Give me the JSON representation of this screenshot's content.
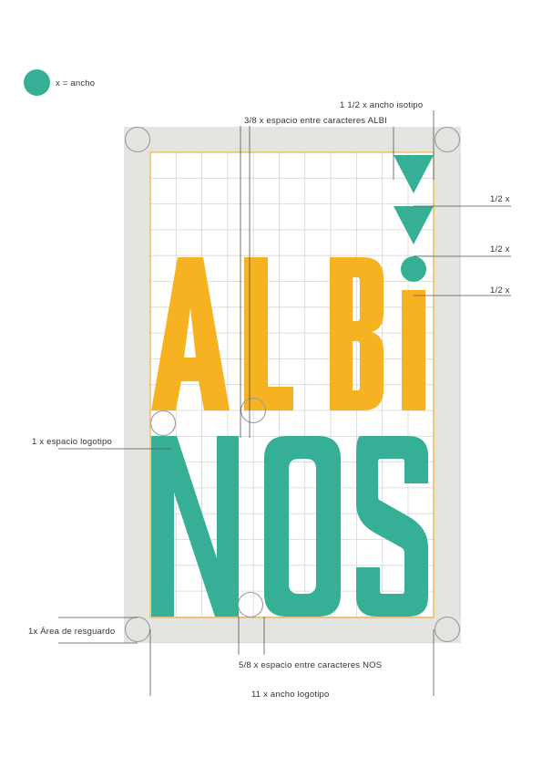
{
  "legend": {
    "label": "x = ancho"
  },
  "annotations": {
    "ancho_isotipo": "1 1/2 x ancho isotipo",
    "espacio_albi": "3/8 x espacio entre caracteres ALBI",
    "half_1": "1/2 x",
    "half_2": "1/2 x",
    "half_3": "1/2 x",
    "espacio_logotipo": "1 x espacio logotipo",
    "area_resguardo": "1x Área de resguardo",
    "espacio_nos": "5/8 x espacio entre caracteres NOS",
    "ancho_logotipo": "11 x ancho logotipo"
  },
  "logo": {
    "line1": [
      "A",
      "L",
      "B",
      "i"
    ],
    "line2": [
      "N",
      "O",
      "S"
    ]
  },
  "colors": {
    "teal": "#35b096",
    "yellow": "#f6b220",
    "margin_gray": "#e4e4e1",
    "grid_gray": "#d6d6d6",
    "guide_orange": "#f1b53a"
  }
}
